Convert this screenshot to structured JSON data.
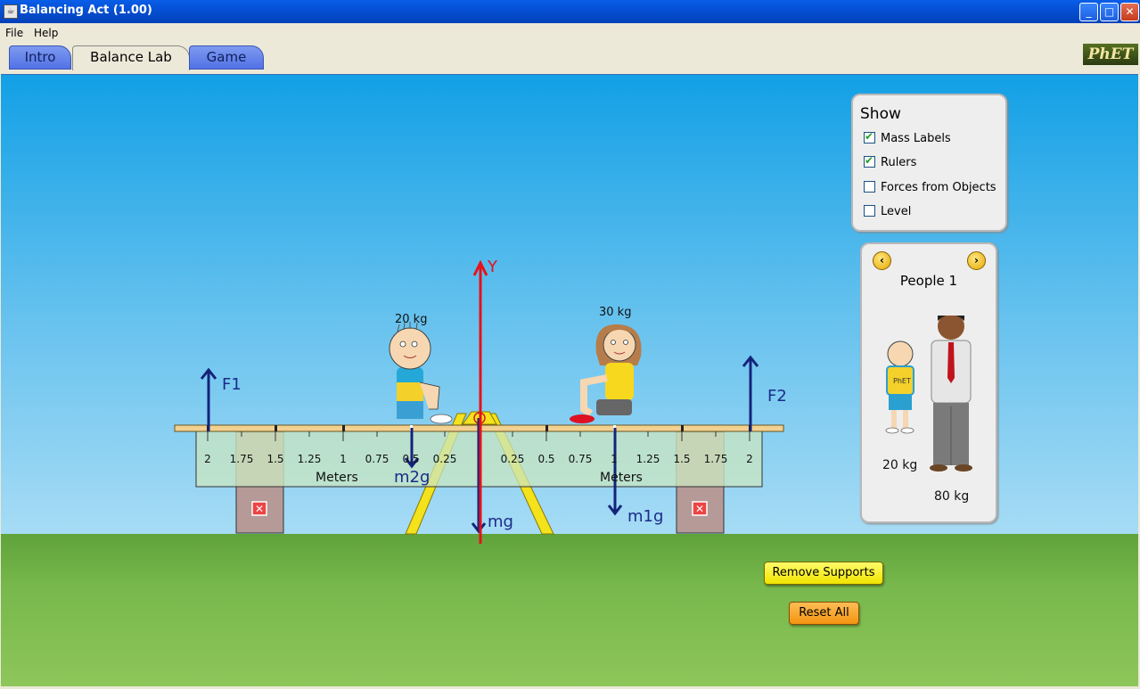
{
  "window": {
    "title": "Balancing Act (1.00)",
    "min": "_",
    "max": "□",
    "close": "✕"
  },
  "menu": {
    "file": "File",
    "help": "Help"
  },
  "tabs": [
    {
      "label": "Intro"
    },
    {
      "label": "Balance Lab"
    },
    {
      "label": "Game"
    }
  ],
  "logo": "PhET",
  "show_panel": {
    "title": "Show",
    "options": [
      {
        "label": "Mass Labels",
        "checked": true
      },
      {
        "label": "Rulers",
        "checked": true
      },
      {
        "label": "Forces from Objects",
        "checked": false
      },
      {
        "label": "Level",
        "checked": false
      }
    ]
  },
  "people_panel": {
    "title": "People 1",
    "people": [
      {
        "mass": "20 kg"
      },
      {
        "mass": "80 kg"
      }
    ]
  },
  "scene": {
    "mass_boy": "20 kg",
    "mass_girl": "30 kg",
    "ruler_unit": "Meters",
    "ruler_ticks": [
      "2",
      "1.75",
      "1.5",
      "1.25",
      "1",
      "0.75",
      "0.5",
      "0.25",
      "0.25",
      "0.5",
      "0.75",
      "1",
      "1.25",
      "1.5",
      "1.75",
      "2"
    ],
    "forces": {
      "f1": "F1",
      "f2": "F2",
      "m1g": "m1g",
      "m2g": "m2g",
      "mg": "mg",
      "y": "Y"
    },
    "colors": {
      "force_arrow": "#14237a",
      "y_axis": "#e8101a",
      "fulcrum": "#f4e21c",
      "plank": "#f2d090"
    }
  },
  "buttons": {
    "remove_supports": "Remove Supports",
    "reset_all": "Reset All"
  }
}
